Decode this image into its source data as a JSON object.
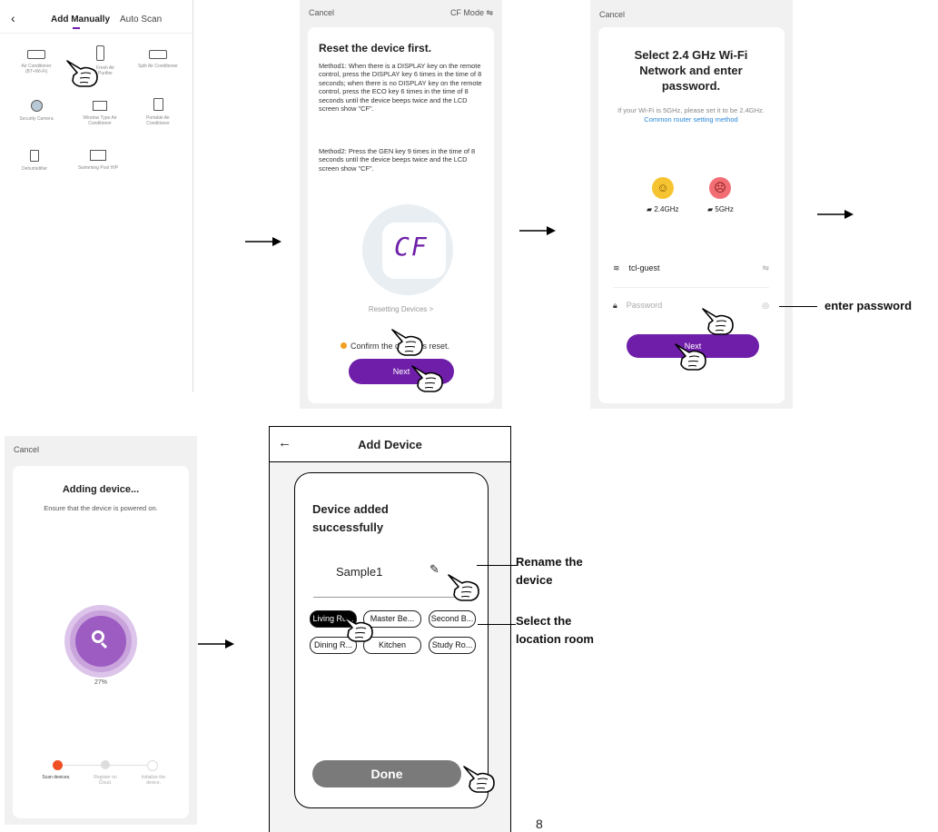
{
  "screen1": {
    "tabs": [
      "Add Manually",
      "Auto Scan"
    ],
    "devices": [
      "Air Conditioner (BT+Wi-Fi)",
      "Fresh Air Purifier",
      "Split Air Conditioner",
      "Security Camera",
      "Window Type Air Conditioner",
      "Portable Air Conditioner",
      "Dehumidifier",
      "Swimming Pool H/P"
    ]
  },
  "screen2": {
    "cancel": "Cancel",
    "mode": "CF Mode ⇋",
    "title": "Reset the device first.",
    "method1": "Method1: When there is a DISPLAY key on the remote control, press the DISPLAY key 6 times in the time of 8 seconds; when there is no DISPLAY key on the remote control, press the ECO key 6 times in the time of 8 seconds until the device beeps twice and the LCD screen show \"CF\".",
    "method2": "Method2: Press the GEN key 9 times in the time of 8 seconds until the device beeps twice and the LCD screen show \"CF\".",
    "display": "CF",
    "resetting": "Resetting Devices >",
    "confirm": "Confirm the device is reset.",
    "next": "Next"
  },
  "screen3": {
    "cancel": "Cancel",
    "title": "Select 2.4 GHz Wi-Fi Network and enter password.",
    "note": "If your Wi-Fi is 5GHz, please set it to be 2.4GHz.",
    "link": "Common router setting method",
    "band_24": "2.4GHz",
    "band_5": "5GHz",
    "ssid": "tcl-guest",
    "password_placeholder": "Password",
    "next": "Next"
  },
  "screen4": {
    "cancel": "Cancel",
    "title": "Adding device...",
    "subtitle": "Ensure that the device is powered on.",
    "progress": "27%",
    "progress_value": 0.27,
    "steps": [
      "Scan devices.",
      "Register on Cloud.",
      "Initialize the device."
    ]
  },
  "screen5": {
    "header": "Add Device",
    "title": "Device added successfully",
    "device_name": "Sample1",
    "rooms": [
      "Living Ro...",
      "Master Be...",
      "Second B...",
      "Dining R...",
      "Kitchen",
      "Study Ro..."
    ],
    "done": "Done"
  },
  "annotations": {
    "password": "enter password",
    "rename": "Rename the device",
    "location": "Select the location room"
  },
  "page_number": "8",
  "colors": {
    "accent": "#6e1ea8",
    "progress_ring": "#c9a3dc",
    "done_button": "#7a7a7a"
  }
}
